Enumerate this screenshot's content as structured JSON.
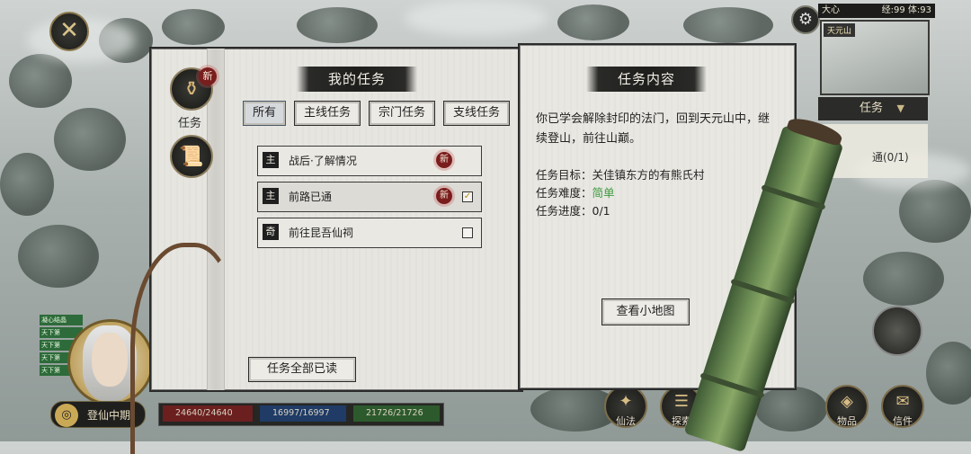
{
  "top": {
    "close_icon": "close-icon",
    "player_name": "大心",
    "level_text": "经:99 体:93",
    "location_label": "天元山"
  },
  "quest_tab": {
    "label": "任务",
    "progress_text": "通(0/1)"
  },
  "side_tabs": [
    {
      "icon": "gourd-icon",
      "label": "任务",
      "badge": "新"
    },
    {
      "icon": "scroll-icon",
      "label": ""
    }
  ],
  "left_page": {
    "title": "我的任务",
    "filters": [
      "所有",
      "主线任务",
      "宗门任务",
      "支线任务"
    ],
    "active_filter": "所有",
    "quests": [
      {
        "tag": "主",
        "name": "战后·了解情况",
        "badge": "新",
        "checked": null
      },
      {
        "tag": "主",
        "name": "前路已通",
        "badge": "新",
        "checked": true
      },
      {
        "tag": "奇",
        "name": "前往昆吾仙祠",
        "badge": "",
        "checked": false
      }
    ],
    "mark_all_read": "任务全部已读"
  },
  "right_page": {
    "title": "任务内容",
    "description": "你已学会解除封印的法门，回到天元山中，继续登山，前往山巅。",
    "goal_label": "任务目标：",
    "goal_value": "关佳镇东方的有熊氏村",
    "difficulty_label": "任务难度：",
    "difficulty_value": "简单",
    "difficulty_color": "#3c9a3c",
    "progress_label": "任务进度：",
    "progress_value": "0/1",
    "view_map_button": "查看小地图"
  },
  "hud": {
    "realm": "登仙中期",
    "hp": "24640/24640",
    "mp": "16997/16997",
    "sp": "21726/21726"
  },
  "buffs": [
    "凝心结晶",
    "天下第",
    "天下第",
    "天下第",
    "天下第"
  ],
  "bottom_menu": [
    {
      "label": "仙法",
      "icon": "immortal-art-icon"
    },
    {
      "label": "探索",
      "icon": "explore-icon"
    },
    {
      "label": "技能",
      "icon": "yinyang-icon"
    },
    {
      "label": "物品",
      "icon": "bag-icon"
    },
    {
      "label": "信件",
      "icon": "letter-icon"
    }
  ]
}
